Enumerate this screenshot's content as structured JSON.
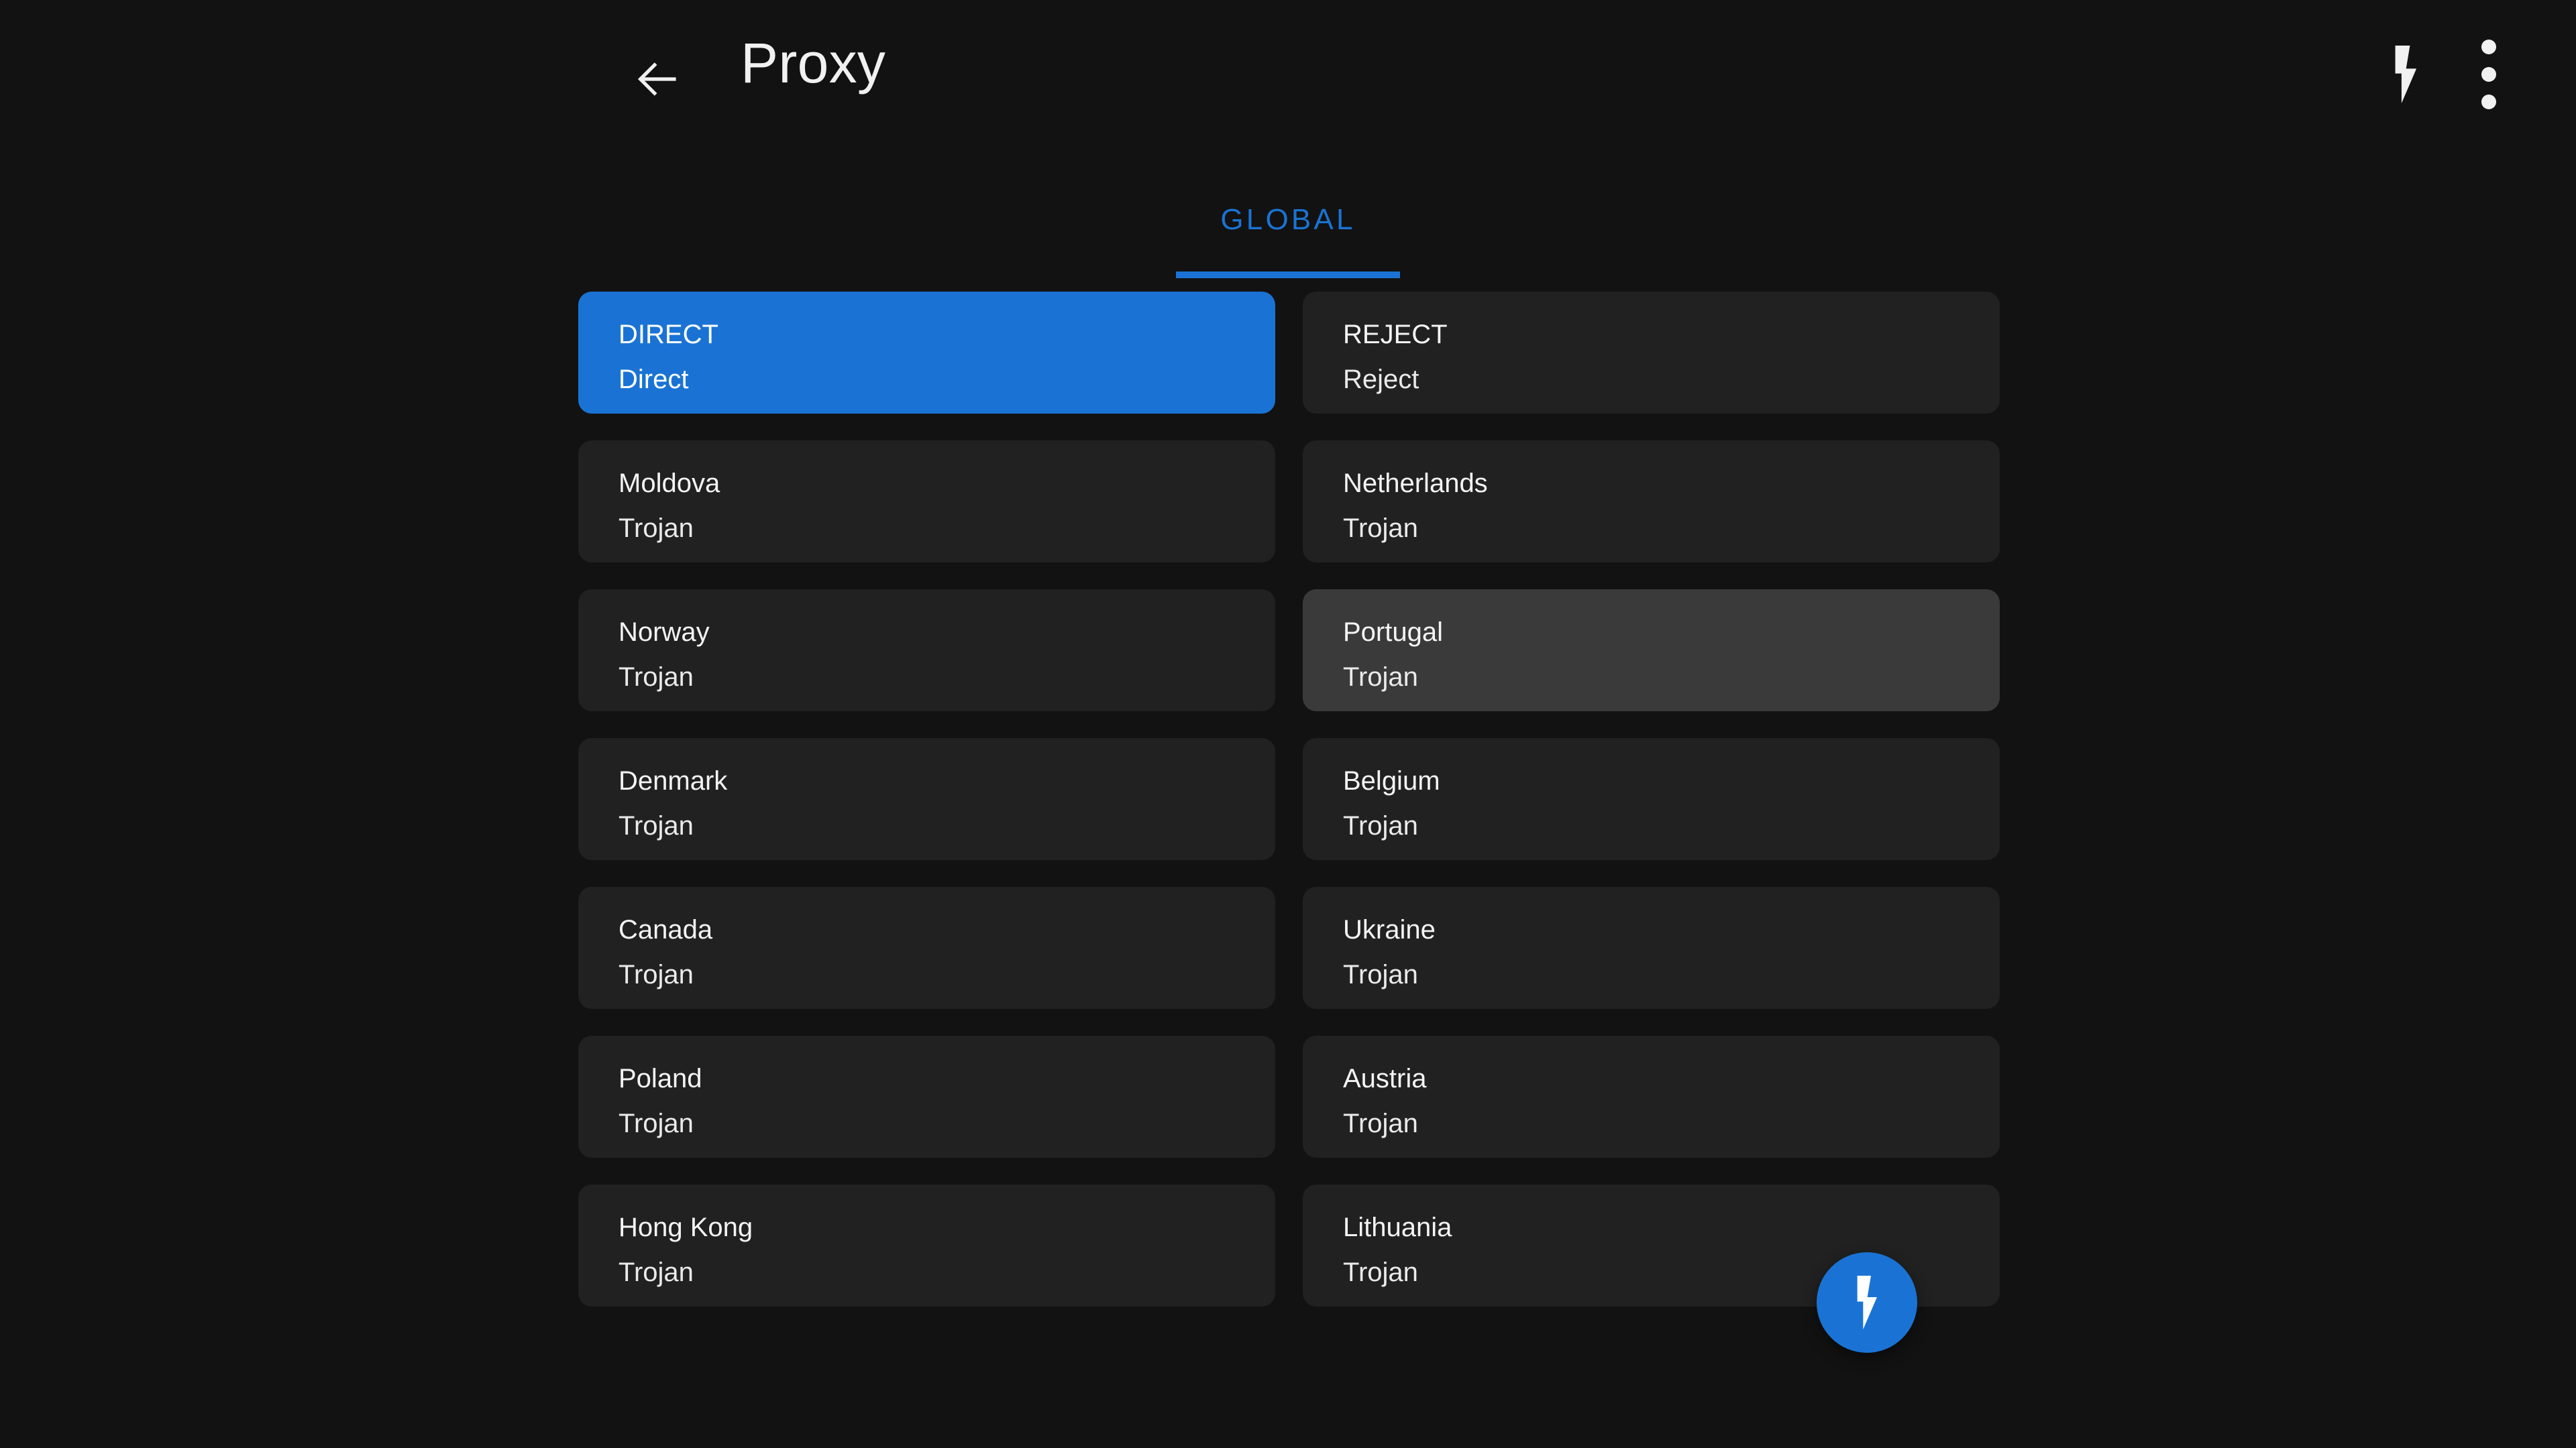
{
  "theme": {
    "background": "#121212",
    "card_background": "#212121",
    "card_hover_background": "#3a3a3a",
    "accent": "#1a73d4",
    "text_primary": "#f4f4f4"
  },
  "appbar": {
    "title": "Proxy",
    "back_icon": "arrow-left-icon",
    "actions": [
      {
        "icon": "lightning-bolt-icon",
        "name": "speed-test-button"
      },
      {
        "icon": "more-vert-icon",
        "name": "overflow-menu-button"
      }
    ]
  },
  "tabs": [
    {
      "label": "GLOBAL",
      "selected": true
    }
  ],
  "proxies": [
    {
      "name": "DIRECT",
      "type": "Direct",
      "state": "selected"
    },
    {
      "name": "REJECT",
      "type": "Reject",
      "state": "normal"
    },
    {
      "name": "Moldova",
      "type": "Trojan",
      "state": "normal"
    },
    {
      "name": "Netherlands",
      "type": "Trojan",
      "state": "normal"
    },
    {
      "name": "Norway",
      "type": "Trojan",
      "state": "normal"
    },
    {
      "name": "Portugal",
      "type": "Trojan",
      "state": "hovered"
    },
    {
      "name": "Denmark",
      "type": "Trojan",
      "state": "normal"
    },
    {
      "name": "Belgium",
      "type": "Trojan",
      "state": "normal"
    },
    {
      "name": "Canada",
      "type": "Trojan",
      "state": "normal"
    },
    {
      "name": "Ukraine",
      "type": "Trojan",
      "state": "normal"
    },
    {
      "name": "Poland",
      "type": "Trojan",
      "state": "normal"
    },
    {
      "name": "Austria",
      "type": "Trojan",
      "state": "normal"
    },
    {
      "name": "Hong Kong",
      "type": "Trojan",
      "state": "normal"
    },
    {
      "name": "Lithuania",
      "type": "Trojan",
      "state": "normal"
    }
  ],
  "fab": {
    "icon": "lightning-bolt-icon",
    "name": "speed-test-fab"
  }
}
